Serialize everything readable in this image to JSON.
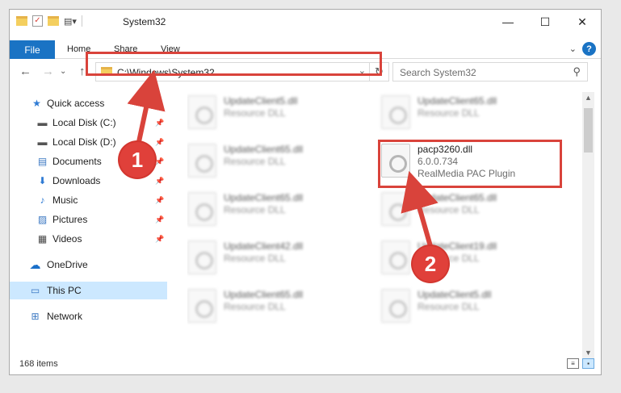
{
  "window": {
    "title": "System32",
    "minimize_glyph": "—",
    "maximize_glyph": "☐",
    "close_glyph": "✕"
  },
  "ribbon": {
    "tabs": [
      {
        "label": "File"
      },
      {
        "label": "Share"
      },
      {
        "label": "View"
      }
    ],
    "home_label": "Home",
    "help_glyph": "?",
    "expand_glyph": "⌄"
  },
  "nav": {
    "back_glyph": "←",
    "forward_glyph": "→",
    "recent_glyph": "⌄",
    "up_glyph": "↑",
    "address": "C:\\Windows\\System32",
    "address_dropdown_glyph": "⌄",
    "refresh_glyph": "↻",
    "search_placeholder": "Search System32",
    "search_glyph": "⚲"
  },
  "sidebar": {
    "items": [
      {
        "label": "Quick access",
        "icon": "star-icon",
        "glyph": "★",
        "color": "#2f7bd4"
      },
      {
        "label": "Local Disk (C:)",
        "icon": "drive-c-icon",
        "glyph": "▬",
        "color": "#555555"
      },
      {
        "label": "Local Disk (D:)",
        "icon": "drive-d-icon",
        "glyph": "▬",
        "color": "#555555"
      },
      {
        "label": "Documents",
        "icon": "documents-icon",
        "glyph": "▤",
        "color": "#3a77c2"
      },
      {
        "label": "Downloads",
        "icon": "downloads-icon",
        "glyph": "⬇",
        "color": "#2f7bd4"
      },
      {
        "label": "Music",
        "icon": "music-icon",
        "glyph": "♪",
        "color": "#2f7bd4"
      },
      {
        "label": "Pictures",
        "icon": "pictures-icon",
        "glyph": "▨",
        "color": "#3a77c2"
      },
      {
        "label": "Videos",
        "icon": "videos-icon",
        "glyph": "▦",
        "color": "#444444"
      },
      {
        "label": "OneDrive",
        "icon": "onedrive-icon",
        "glyph": "☁",
        "color": "#1a6fc9"
      },
      {
        "label": "This PC",
        "icon": "this-pc-icon",
        "glyph": "▭",
        "color": "#3a77c2"
      },
      {
        "label": "Network",
        "icon": "network-icon",
        "glyph": "⊞",
        "color": "#3a77c2"
      }
    ],
    "pin_glyph": "📌"
  },
  "files": {
    "left_column": [
      {
        "name": "UpdateClient5.dll",
        "type": "Resource DLL"
      },
      {
        "name": "UpdateClient65.dll",
        "type": "Resource DLL"
      },
      {
        "name": "UpdateClient65.dll",
        "type": "Resource DLL"
      },
      {
        "name": "UpdateClient42.dll",
        "type": "Resource DLL"
      },
      {
        "name": "UpdateClient65.dll",
        "type": "Resource DLL"
      }
    ],
    "right_column": [
      {
        "name": "UpdateClient65.dll",
        "type": "Resource DLL"
      },
      {
        "name": "UpdateClient65.dll",
        "type": "Resource DLL"
      },
      {
        "name": "UpdateClient19.dll",
        "type": "Resource DLL"
      },
      {
        "name": "UpdateClient5.dll",
        "type": "Resource DLL"
      }
    ],
    "highlighted": {
      "name": "pacp3260.dll",
      "version": "6.0.0.734",
      "description": "RealMedia PAC Plugin"
    }
  },
  "status": {
    "item_count": "168 items"
  },
  "annotations": {
    "badge1": "1",
    "badge2": "2",
    "color": "#d9433b"
  }
}
